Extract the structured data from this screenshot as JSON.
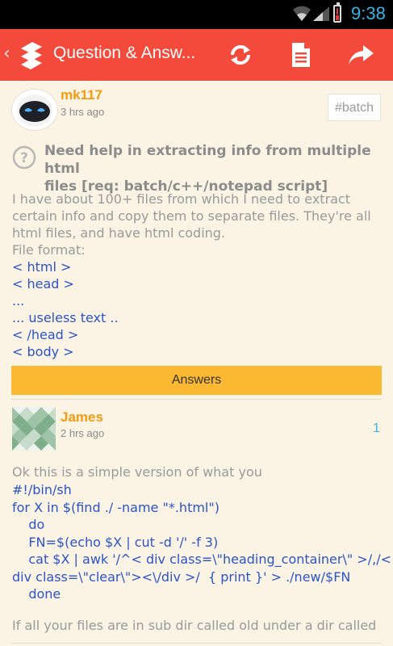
{
  "status_bar": {
    "time": "9:38",
    "icons": [
      "wifi-icon",
      "signal-icon",
      "battery-low-icon"
    ],
    "time_color": "#33b5e5"
  },
  "app_bar": {
    "title": "Question & Answ...",
    "color": "#f44a3c",
    "icons": [
      "back-icon",
      "app-logo",
      "refresh-icon",
      "document-icon",
      "share-icon"
    ]
  },
  "question": {
    "username": "mk117",
    "time": "3 hrs ago",
    "tag": "#batch",
    "title_lines": [
      "Need help in extracting info from multiple html",
      "files [req: batch/c++/notepad script]"
    ],
    "body_lines": [
      "I have about 100+ files from which I need to extract",
      "certain info and copy them to separate files. They're all",
      "html files, and have html coding.",
      "File format:"
    ],
    "code_lines": [
      "< html >",
      "< head >",
      "...",
      "... useless text ..",
      "< /head >",
      "< body >"
    ]
  },
  "answers_label": "Answers",
  "answer": {
    "username": "James",
    "time": "2 hrs ago",
    "votes": "1",
    "intro": "Ok this is a simple version of what you",
    "code_lines": [
      "#!/bin/sh",
      "for X in $(find ./ -name \"*.html\")",
      "    do",
      "    FN=$(echo $X | cut -d '/' -f 3)",
      "    cat $X | awk '/^< div class=\\\"heading_container\\\" >/,/<",
      "div class=\\\"clear\\\"><\\/div >/  { print }' > ./new/$FN",
      "    done"
    ],
    "footer": "If all your files are in sub dir called old under a dir called"
  },
  "colors": {
    "username": "#f39c12",
    "code": "#2b54c8",
    "answers_bar": "#fbb932",
    "background": "#fbf3e3"
  }
}
